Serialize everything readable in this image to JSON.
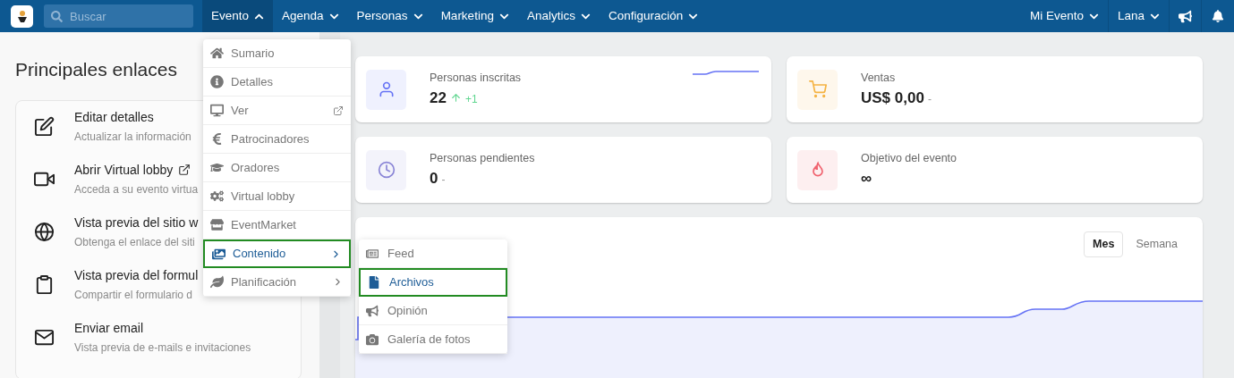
{
  "navbar": {
    "search_placeholder": "Buscar",
    "menus": [
      {
        "label": "Evento",
        "expanded": true
      },
      {
        "label": "Agenda",
        "expanded": false
      },
      {
        "label": "Personas",
        "expanded": false
      },
      {
        "label": "Marketing",
        "expanded": false
      },
      {
        "label": "Analytics",
        "expanded": false
      },
      {
        "label": "Configuración",
        "expanded": false
      }
    ],
    "right_menus": [
      {
        "label": "Mi Evento"
      },
      {
        "label": "Lana"
      }
    ]
  },
  "quick_links": {
    "title": "Principales enlaces",
    "items": [
      {
        "title": "Editar detalles",
        "description": "Actualizar la información",
        "external": false
      },
      {
        "title": "Abrir Virtual lobby",
        "description": "Acceda a su evento virtua",
        "external": true
      },
      {
        "title": "Vista previa del sitio w",
        "description": "Obtenga el enlace del siti",
        "external": false
      },
      {
        "title": "Vista previa del formul",
        "description": "Compartir el formulario d",
        "external": false
      },
      {
        "title": "Enviar email",
        "description": "Vista previa de e-mails e invitaciones",
        "external": false
      }
    ]
  },
  "stats": [
    {
      "label": "Personas inscritas",
      "value": "22",
      "change": "+1",
      "kind": "up",
      "color": "#6673f5",
      "sparkline": true
    },
    {
      "label": "Ventas",
      "value": "US$ 0,00",
      "change": "-",
      "kind": "flat",
      "color": "#f5b342",
      "sparkline": false
    },
    {
      "label": "Personas pendientes",
      "value": "0",
      "change": "-",
      "kind": "flat",
      "color": "#8a85d6",
      "sparkline": false
    },
    {
      "label": "Objetivo del evento",
      "value": "∞",
      "kind": "none",
      "color": "#f0626e",
      "sparkline": false
    }
  ],
  "chart": {
    "tabs": [
      {
        "label": "Mes",
        "selected": true
      },
      {
        "label": "Semana",
        "selected": false
      }
    ]
  },
  "evento_menu": [
    {
      "label": "Sumario",
      "kind": "link",
      "selected": false
    },
    {
      "label": "Detalles",
      "kind": "link",
      "selected": false
    },
    {
      "label": "Ver",
      "kind": "external",
      "selected": false
    },
    {
      "label": "Patrocinadores",
      "kind": "link",
      "selected": false
    },
    {
      "label": "Oradores",
      "kind": "link",
      "selected": false
    },
    {
      "label": "Virtual lobby",
      "kind": "link",
      "selected": false
    },
    {
      "label": "EventMarket",
      "kind": "link",
      "selected": false
    },
    {
      "label": "Contenido",
      "kind": "submenu",
      "selected": true
    },
    {
      "label": "Planificación",
      "kind": "submenu",
      "selected": false
    }
  ],
  "contenido_submenu": [
    {
      "label": "Feed",
      "selected": false
    },
    {
      "label": "Archivos",
      "selected": true
    },
    {
      "label": "Opinión",
      "selected": false
    },
    {
      "label": "Galería de fotos",
      "selected": false
    }
  ]
}
